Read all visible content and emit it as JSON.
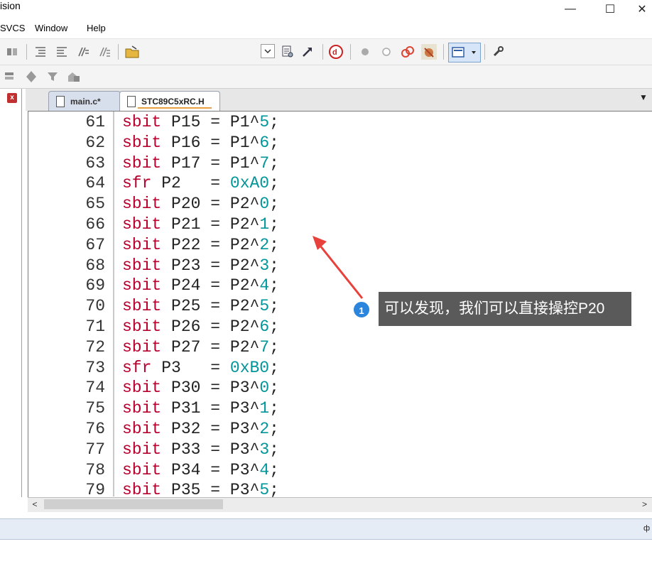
{
  "window": {
    "title_fragment": "ision",
    "minimize_icon": "—",
    "maximize_icon": "☐",
    "close_icon": "✕"
  },
  "menubar": {
    "items": [
      "SVCS",
      "Window",
      "Help"
    ]
  },
  "tabs": [
    {
      "label": "main.c*",
      "active": false
    },
    {
      "label": "STC89C5xRC.H",
      "active": true
    }
  ],
  "editor": {
    "lines": [
      {
        "num": "61",
        "kw": "sbit",
        "name": "P15",
        "op": "=",
        "val": "P1^",
        "vnum": "5"
      },
      {
        "num": "62",
        "kw": "sbit",
        "name": "P16",
        "op": "=",
        "val": "P1^",
        "vnum": "6"
      },
      {
        "num": "63",
        "kw": "sbit",
        "name": "P17",
        "op": "=",
        "val": "P1^",
        "vnum": "7"
      },
      {
        "num": "64",
        "kw": "sfr",
        "name": "P2 ",
        "op": "=",
        "val": "",
        "vnum": "0xA0"
      },
      {
        "num": "65",
        "kw": "sbit",
        "name": "P20",
        "op": "=",
        "val": "P2^",
        "vnum": "0"
      },
      {
        "num": "66",
        "kw": "sbit",
        "name": "P21",
        "op": "=",
        "val": "P2^",
        "vnum": "1"
      },
      {
        "num": "67",
        "kw": "sbit",
        "name": "P22",
        "op": "=",
        "val": "P2^",
        "vnum": "2"
      },
      {
        "num": "68",
        "kw": "sbit",
        "name": "P23",
        "op": "=",
        "val": "P2^",
        "vnum": "3"
      },
      {
        "num": "69",
        "kw": "sbit",
        "name": "P24",
        "op": "=",
        "val": "P2^",
        "vnum": "4"
      },
      {
        "num": "70",
        "kw": "sbit",
        "name": "P25",
        "op": "=",
        "val": "P2^",
        "vnum": "5"
      },
      {
        "num": "71",
        "kw": "sbit",
        "name": "P26",
        "op": "=",
        "val": "P2^",
        "vnum": "6"
      },
      {
        "num": "72",
        "kw": "sbit",
        "name": "P27",
        "op": "=",
        "val": "P2^",
        "vnum": "7"
      },
      {
        "num": "73",
        "kw": "sfr",
        "name": "P3 ",
        "op": "=",
        "val": "",
        "vnum": "0xB0"
      },
      {
        "num": "74",
        "kw": "sbit",
        "name": "P30",
        "op": "=",
        "val": "P3^",
        "vnum": "0"
      },
      {
        "num": "75",
        "kw": "sbit",
        "name": "P31",
        "op": "=",
        "val": "P3^",
        "vnum": "1"
      },
      {
        "num": "76",
        "kw": "sbit",
        "name": "P32",
        "op": "=",
        "val": "P3^",
        "vnum": "2"
      },
      {
        "num": "77",
        "kw": "sbit",
        "name": "P33",
        "op": "=",
        "val": "P3^",
        "vnum": "3"
      },
      {
        "num": "78",
        "kw": "sbit",
        "name": "P34",
        "op": "=",
        "val": "P3^",
        "vnum": "4"
      },
      {
        "num": "79",
        "kw": "sbit",
        "name": "P35",
        "op": "=",
        "val": "P3^",
        "vnum": "5"
      }
    ]
  },
  "annotation": {
    "badge": "1",
    "text": "可以发现，我们可以直接操控P20",
    "arrow_color": "#e8413c"
  },
  "colors": {
    "keyword": "#b8002e",
    "number": "#00969a",
    "badge": "#2c85dd",
    "tab_underline": "#e8a040"
  },
  "scrollbar": {
    "left_arrow": "<",
    "right_arrow": ">"
  },
  "bottom": {
    "pin_icon": "ф"
  }
}
